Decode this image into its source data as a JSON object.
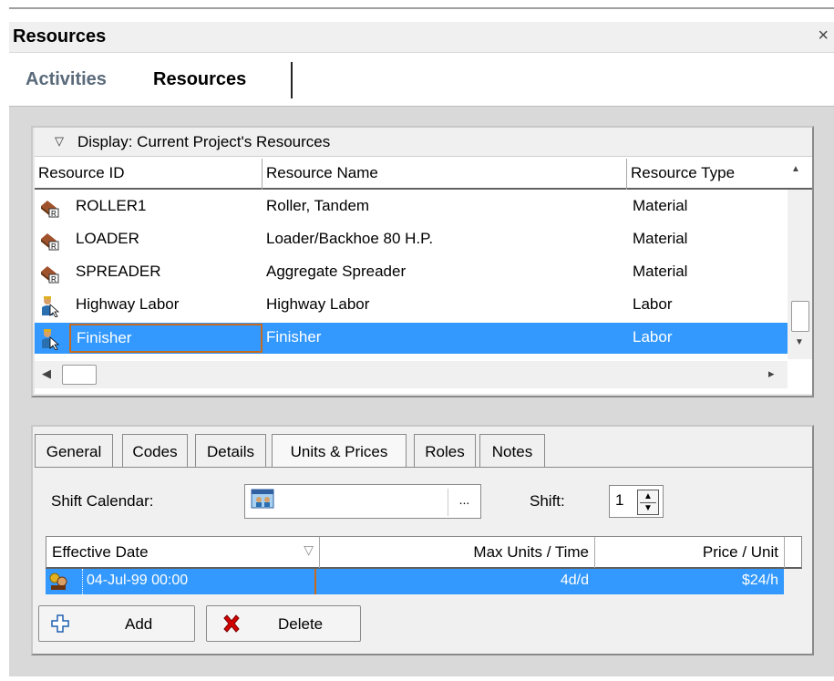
{
  "panel": {
    "title": "Resources",
    "close_glyph": "×"
  },
  "top_tabs": [
    {
      "label": "Activities",
      "active": false
    },
    {
      "label": "Resources",
      "active": true
    }
  ],
  "resources": {
    "display_label": "Display: Current Project's Resources",
    "columns": [
      "Resource ID",
      "Resource Name",
      "Resource Type"
    ],
    "rows": [
      {
        "id": "ROLLER1",
        "name": "Roller, Tandem",
        "type": "Material",
        "icon": "material-resource-icon",
        "selected": false
      },
      {
        "id": "LOADER",
        "name": "Loader/Backhoe 80 H.P.",
        "type": "Material",
        "icon": "material-resource-icon",
        "selected": false
      },
      {
        "id": "SPREADER",
        "name": "Aggregate Spreader",
        "type": "Material",
        "icon": "material-resource-icon",
        "selected": false
      },
      {
        "id": "Highway Labor",
        "name": "Highway Labor",
        "type": "Labor",
        "icon": "labor-resource-icon",
        "selected": false
      },
      {
        "id": "Finisher",
        "name": "Finisher",
        "type": "Labor",
        "icon": "labor-resource-icon",
        "selected": true
      }
    ]
  },
  "detail_tabs": [
    {
      "label": "General",
      "active": false
    },
    {
      "label": "Codes",
      "active": false
    },
    {
      "label": "Details",
      "active": false
    },
    {
      "label": "Units & Prices",
      "active": true
    },
    {
      "label": "Roles",
      "active": false
    },
    {
      "label": "Notes",
      "active": false
    }
  ],
  "units_prices": {
    "shift_calendar_label": "Shift Calendar:",
    "calendar_value": "",
    "ellipsis": "...",
    "shift_label": "Shift:",
    "shift_value": "1",
    "columns": [
      "Effective Date",
      "Max Units / Time",
      "Price / Unit"
    ],
    "rows": [
      {
        "date": "04-Jul-99 00:00",
        "units": "4d/d",
        "price": "$24/h",
        "selected": true
      }
    ],
    "add_label": "Add",
    "delete_label": "Delete"
  },
  "colors": {
    "selection": "#3399ff",
    "focus_border": "#c76a1e",
    "panel_bg": "#d9d9d9",
    "delete_x": "#d40000"
  }
}
